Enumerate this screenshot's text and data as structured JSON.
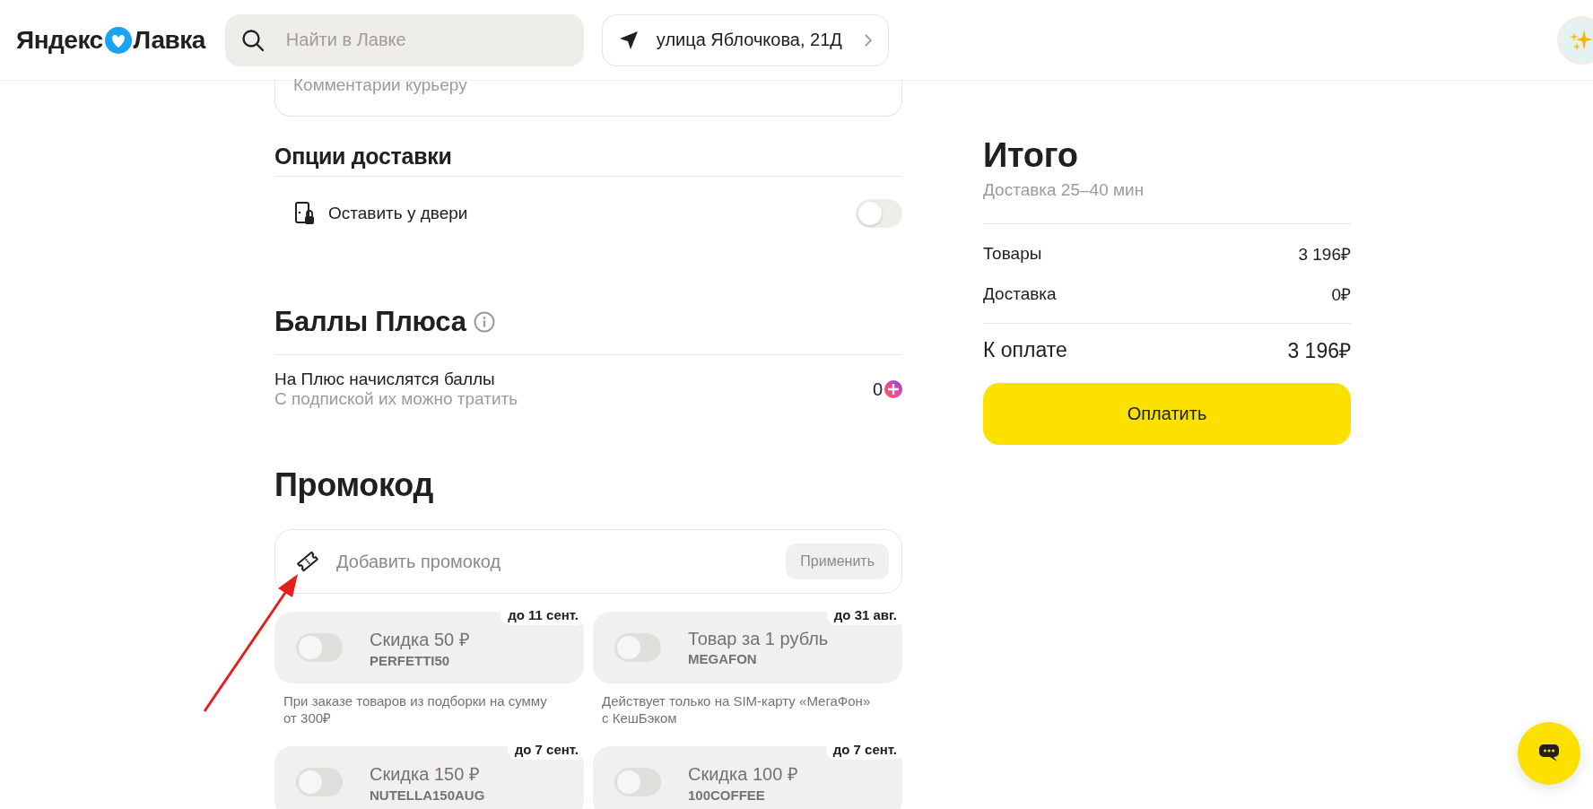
{
  "header": {
    "logo_left": "Яндекс",
    "logo_right": "Лавка",
    "search": {
      "placeholder": "Найти в Лавке"
    },
    "address": "улица Яблочкова, 21Д"
  },
  "comment": {
    "placeholder": "Комментарии курьеру"
  },
  "delivery_options": {
    "title": "Опции доставки",
    "items": [
      {
        "label": "Оставить у двери",
        "on": false
      }
    ]
  },
  "plus": {
    "title": "Баллы Плюса",
    "line": "На Плюс начислятся баллы",
    "subline": "С подпиской их можно тратить",
    "points": "0"
  },
  "promo": {
    "title": "Промокод",
    "placeholder": "Добавить промокод",
    "apply": "Применить",
    "cards": [
      {
        "title": "Скидка 50 ₽",
        "code": "PERFETTI50",
        "expiry": "до 11 сент.",
        "description": "При заказе товаров из подборки на сумму от 300₽",
        "on": false
      },
      {
        "title": "Товар за 1 рубль",
        "code": "MEGAFON",
        "expiry": "до 31 авг.",
        "description": "Действует только на SIM-карту «МегаФон» с КешБэком",
        "on": false
      },
      {
        "title": "Скидка 150 ₽",
        "code": "NUTELLA150AUG",
        "expiry": "до 7 сент.",
        "on": false
      },
      {
        "title": "Скидка 100 ₽",
        "code": "100COFFEE",
        "expiry": "до 7 сент.",
        "on": false
      }
    ]
  },
  "summary": {
    "title": "Итого",
    "subtitle": "Доставка 25–40 мин",
    "rows": [
      {
        "label": "Товары",
        "value": "3 196₽"
      },
      {
        "label": "Доставка",
        "value": "0₽"
      }
    ],
    "total": {
      "label": "К оплате",
      "value": "3 196₽"
    },
    "pay": "Оплатить"
  }
}
